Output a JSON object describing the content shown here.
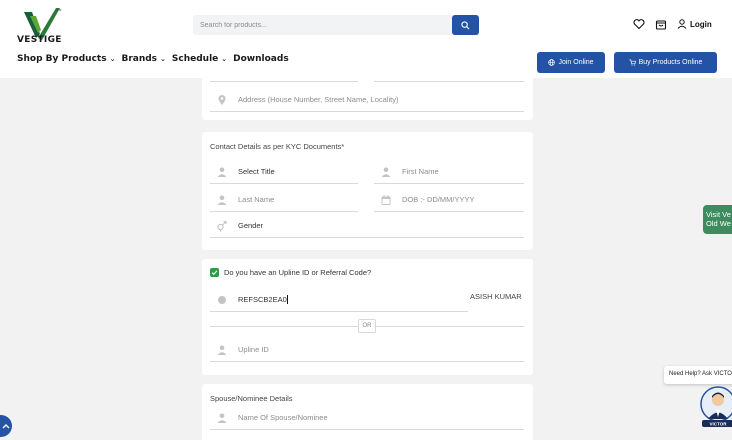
{
  "header": {
    "logo_text": "VESTIGE",
    "search": {
      "placeholder": "Search for products..."
    },
    "login_label": "Login"
  },
  "nav": {
    "items": [
      {
        "label": "Shop By Products"
      },
      {
        "label": "Brands"
      },
      {
        "label": "Schedule"
      },
      {
        "label": "Downloads"
      }
    ],
    "join_online": "Join Online",
    "buy_products_online": "Buy Products Online"
  },
  "form": {
    "address_placeholder": "Address (House Number, Street Name, Locality)",
    "contact": {
      "title": "Contact Details as per KYC Documents*",
      "select_title": "Select Title",
      "first_name": "First Name",
      "last_name": "Last Name",
      "dob": "DOB :- DD/MM/YYYY",
      "gender": "Gender"
    },
    "upline": {
      "checkbox_label": "Do you have an Upline ID or Referral Code?",
      "checked": true,
      "referral_code": "REFSCB2EA0",
      "resolved_name": "ASISH KUMAR",
      "or_label": "OR",
      "upline_id_placeholder": "Upline ID"
    },
    "nominee": {
      "title": "Spouse/Nominee Details",
      "name_placeholder": "Name Of Spouse/Nominee"
    }
  },
  "side": {
    "visit_line1": "Visit Ve",
    "visit_line2": "Old We",
    "help_text": "Need Help? Ask VICTO"
  },
  "colors": {
    "primary": "#2453a6",
    "logo_green": "#5aa832",
    "logo_dark": "#1b5e3a",
    "visit_tab": "#3d8b5f",
    "checkbox": "#2e9a4a"
  }
}
